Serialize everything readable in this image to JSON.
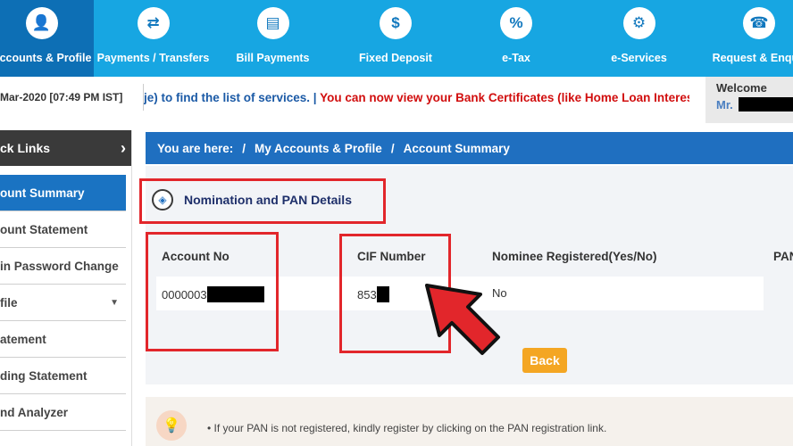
{
  "nav": {
    "items": [
      {
        "label": "Accounts & Profile",
        "icon": "person-icon",
        "glyph": "👤"
      },
      {
        "label": "Payments / Transfers",
        "icon": "transfer-icon",
        "glyph": "⇄"
      },
      {
        "label": "Bill Payments",
        "icon": "bill-icon",
        "glyph": "▤"
      },
      {
        "label": "Fixed Deposit",
        "icon": "deposit-icon",
        "glyph": "$"
      },
      {
        "label": "e-Tax",
        "icon": "tax-icon",
        "glyph": "%"
      },
      {
        "label": "e-Services",
        "icon": "services-icon",
        "glyph": "⚙"
      },
      {
        "label": "Request & Enquir",
        "icon": "phone-icon",
        "glyph": "☎"
      }
    ],
    "active_color": "#0d6fb5",
    "bar_color": "#17a6e2"
  },
  "info": {
    "datetime": "Mar-2020 [07:49 PM IST]",
    "ticker_blue": "je) to find the list of services. | ",
    "ticker_red": "You can now view your Bank Certificates (like Home Loan Interest certific",
    "welcome_label": "Welcome",
    "welcome_name": "Mr."
  },
  "sidebar": {
    "header": "ck Links",
    "items": [
      {
        "label": "ount Summary",
        "active": true
      },
      {
        "label": "ount Statement",
        "active": false
      },
      {
        "label": "in Password Change",
        "active": false
      },
      {
        "label": "file",
        "active": false,
        "caret": "▼"
      },
      {
        "label": "atement",
        "active": false
      },
      {
        "label": "ding Statement",
        "active": false
      },
      {
        "label": "nd Analyzer",
        "active": false
      }
    ]
  },
  "breadcrumb": {
    "prefix": "You are here:",
    "sep": "/",
    "level1": "My Accounts & Profile",
    "level2": "Account Summary"
  },
  "section": {
    "title": "Nomination and PAN Details"
  },
  "table": {
    "headers": [
      "Account No",
      "CIF Number",
      "Nominee Registered(Yes/No)",
      "PAN"
    ],
    "row": {
      "account_no": "0000003",
      "cif_number": "853",
      "nominee": "No"
    }
  },
  "buttons": {
    "back": "Back"
  },
  "note": {
    "text": "• If your PAN is not registered, kindly register by clicking on the PAN registration link."
  },
  "colors": {
    "highlight": "#e2262b",
    "arrow": "#e2262b",
    "back_button": "#f4a623"
  }
}
